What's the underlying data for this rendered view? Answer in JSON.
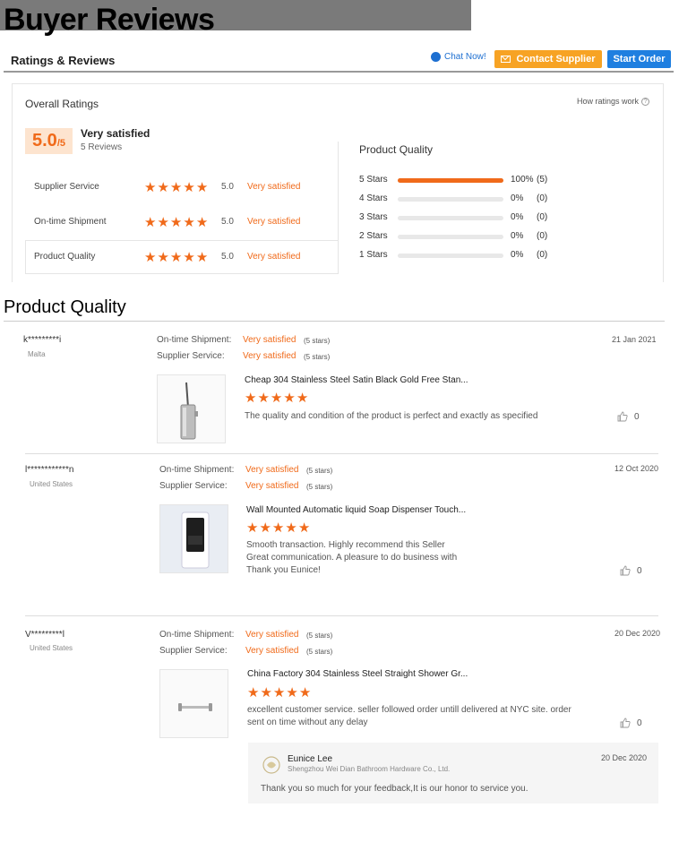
{
  "banner": {
    "title": "Buyer Reviews"
  },
  "header": {
    "title": "Ratings & Reviews",
    "chat_label": "Chat Now!",
    "contact_label": "Contact Supplier",
    "start_label": "Start Order"
  },
  "overall": {
    "title": "Overall Ratings",
    "how_label": "How ratings work",
    "score": "5.0",
    "score_max": "/5",
    "score_text": "Very satisfied",
    "review_count": "5 Reviews",
    "rows": [
      {
        "label": "Supplier Service",
        "stars": 5,
        "value": "5.0",
        "text": "Very satisfied"
      },
      {
        "label": "On-time Shipment",
        "stars": 5,
        "value": "5.0",
        "text": "Very satisfied"
      },
      {
        "label": "Product Quality",
        "stars": 5,
        "value": "5.0",
        "text": "Very satisfied"
      }
    ]
  },
  "product_quality": {
    "title": "Product Quality",
    "bars": [
      {
        "label": "5  Stars",
        "fraction": 1.0,
        "pct": "100%",
        "count": "(5)"
      },
      {
        "label": "4  Stars",
        "fraction": 0,
        "pct": "0%",
        "count": "(0)"
      },
      {
        "label": "3  Stars",
        "fraction": 0,
        "pct": "0%",
        "count": "(0)"
      },
      {
        "label": "2  Stars",
        "fraction": 0,
        "pct": "0%",
        "count": "(0)"
      },
      {
        "label": "1  Stars",
        "fraction": 0,
        "pct": "0%",
        "count": "(0)"
      }
    ]
  },
  "section_title": "Product Quality",
  "reviews": [
    {
      "user": "k*********i",
      "country": "Malta",
      "shipment_label": "On-time Shipment:",
      "shipment_value": "Very satisfied",
      "shipment_stars": "(5 stars)",
      "service_label": "Supplier Service:",
      "service_value": "Very satisfied",
      "service_stars": "(5 stars)",
      "date": "21 Jan 2021",
      "product_title": "Cheap 304 Stainless Steel Satin Black Gold Free Stan...",
      "rating": 5,
      "comment": [
        "The quality and condition of the product is perfect and exactly as specified"
      ],
      "likes": "0",
      "image": "toilet-brush"
    },
    {
      "user": "l************n",
      "country": "United States",
      "shipment_label": "On-time Shipment:",
      "shipment_value": "Very satisfied",
      "shipment_stars": "(5 stars)",
      "service_label": "Supplier Service:",
      "service_value": "Very satisfied",
      "service_stars": "(5 stars)",
      "date": "12 Oct 2020",
      "product_title": "Wall Mounted Automatic liquid Soap Dispenser Touch...",
      "rating": 5,
      "comment": [
        "Smooth transaction. Highly recommend this Seller",
        "Great communication. A pleasure to do business with",
        "Thank you Eunice!"
      ],
      "likes": "0",
      "image": "soap-dispenser"
    },
    {
      "user": "V*********l",
      "country": "United States",
      "shipment_label": "On-time Shipment:",
      "shipment_value": "Very satisfied",
      "shipment_stars": "(5 stars)",
      "service_label": "Supplier Service:",
      "service_value": "Very satisfied",
      "service_stars": "(5 stars)",
      "date": "20 Dec 2020",
      "product_title": "China Factory 304 Stainless Steel Straight Shower Gr...",
      "rating": 5,
      "comment": [
        "excellent customer service. seller followed order untill delivered at NYC site. order",
        "sent on time without any delay"
      ],
      "likes": "0",
      "image": "grab-bar"
    }
  ],
  "reply": {
    "name": "Eunice Lee",
    "company": "Shengzhou Wei Dian Bathroom Hardware Co., Ltd.",
    "date": "20 Dec 2020",
    "text": "Thank you so much for your feedback,It is our honor to service you."
  },
  "colors": {
    "accent": "#f06a1a",
    "contact": "#f7a324",
    "start": "#1f7fe0",
    "chat": "#1d6fd1"
  }
}
